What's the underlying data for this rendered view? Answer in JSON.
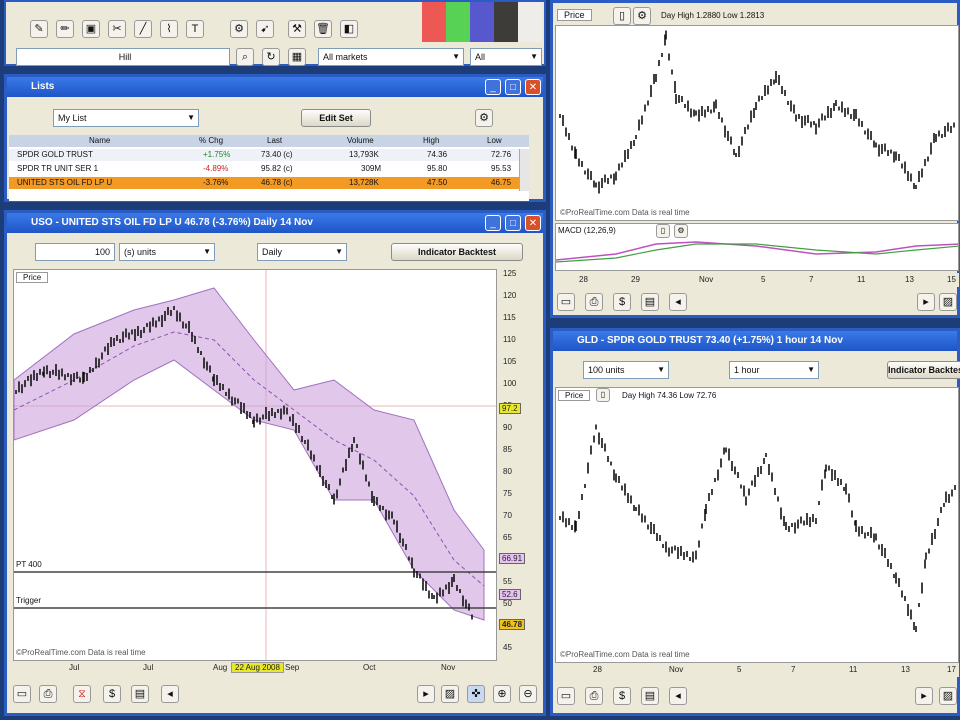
{
  "toolbar": {
    "icons": [
      "pen-icon",
      "pencil-icon",
      "briefcase-icon",
      "scissors-icon",
      "line-icon",
      "fib-icon",
      "text-icon",
      "gear-icon",
      "arrow-icon",
      "tools-icon",
      "trash-icon",
      "color-swatch-icon"
    ],
    "combo1": "Hill",
    "combo2": "All markets",
    "combo3": "All"
  },
  "watchlist": {
    "title": "Lists",
    "list_select": "My List",
    "edit_button": "Edit Set",
    "columns": [
      "Name",
      "% Chg",
      "Last",
      "Volume",
      "High",
      "Low"
    ],
    "rows": [
      {
        "name": "SPDR GOLD TRUST",
        "chg": "+1.75%",
        "last": "73.40 (c)",
        "vol": "13,793K",
        "high": "74.36",
        "low": "72.76"
      },
      {
        "name": "SPDR TR UNIT SER 1",
        "chg": "-4.89%",
        "last": "95.82 (c)",
        "vol": "309M",
        "high": "95.80",
        "low": "95.53"
      },
      {
        "name": "UNITED STS OIL FD LP U",
        "chg": "-3.76%",
        "last": "46.78 (c)",
        "vol": "13,728K",
        "high": "47.50",
        "low": "46.75"
      }
    ]
  },
  "main_chart": {
    "title": "USO - UNITED STS OIL FD LP U    46.78 (-3.76%)    Daily    14 Nov",
    "units_value": "100",
    "units_label": "(s) units",
    "interval": "Daily",
    "backtest_button": "Indicator Backtest",
    "price_label": "Price",
    "y_ticks": [
      "125",
      "120",
      "115",
      "110",
      "105",
      "100",
      "95",
      "90",
      "85",
      "80",
      "75",
      "70",
      "65",
      "60",
      "55",
      "50",
      "45"
    ],
    "x_ticks": [
      "Jul",
      "Jul",
      "Aug",
      "Sep",
      "Oct",
      "Nov"
    ],
    "tags": [
      "97.2",
      "66.91",
      "52.6",
      "46.78"
    ],
    "hlines": [
      "PT 400",
      "Trigger"
    ],
    "watermark": "©ProRealTime.com   Data is real time",
    "date_marker": "22 Aug 2008"
  },
  "spy_chart": {
    "header": "Price",
    "ohlc": "Day  High 1.2880 Low 1.2813",
    "watermark": "©ProRealTime.com   Data is real time",
    "macd_label": "MACD (12,26,9)",
    "x_ticks": [
      "28",
      "29",
      "Nov",
      "5",
      "7",
      "11",
      "13",
      "15"
    ]
  },
  "gld_chart": {
    "title": "GLD - SPDR GOLD TRUST    73.40 (+1.75%)    1 hour    14 Nov",
    "units": "100 units",
    "interval": "1 hour",
    "backtest_button": "Indicator Backtest",
    "price_label": "Price",
    "ohlc": "Day  High 74.36 Low 72.76",
    "watermark": "©ProRealTime.com   Data is real time",
    "x_ticks": [
      "28",
      "Nov",
      "5",
      "7",
      "11",
      "13",
      "17"
    ]
  },
  "colors": {
    "band": "#c89adb",
    "title_blue": "#2a5cc4",
    "highlight_row": "#f39a24",
    "marker_yellow": "#e8e82a"
  }
}
